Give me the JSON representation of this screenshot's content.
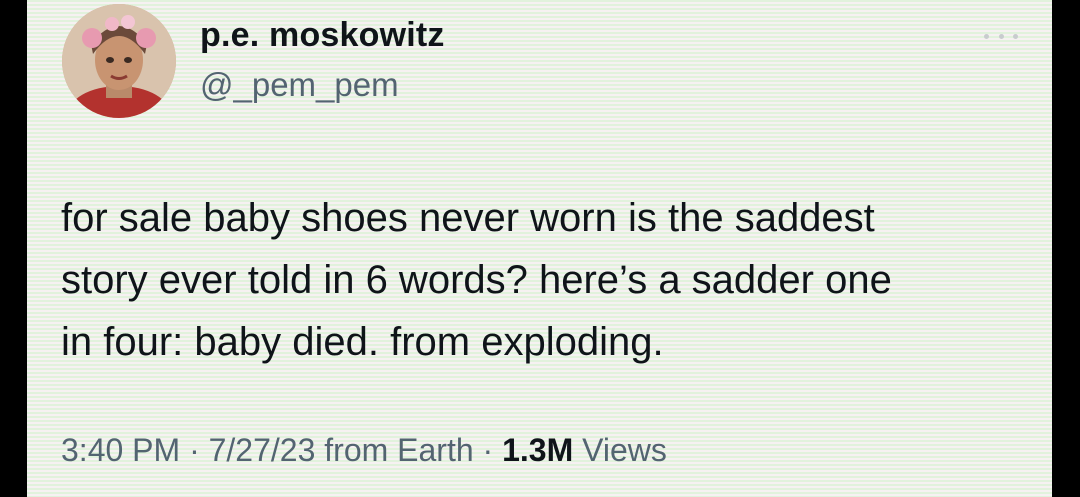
{
  "author": {
    "display_name": "p.e. moskowitz",
    "handle": "@_pem_pem",
    "avatar_icon": "profile-avatar"
  },
  "more_icon": "more-dots-icon",
  "tweet": {
    "lines": [
      "for sale baby shoes never worn is the saddest",
      "story ever told in 6 words? here’s a sadder one",
      "in four: baby died. from exploding."
    ]
  },
  "meta": {
    "time": "3:40 PM",
    "separator": "·",
    "date": "7/27/23",
    "source_prefix": "from",
    "source": "Earth",
    "views_count": "1.3M",
    "views_label": "Views"
  },
  "colors": {
    "background": "#000000",
    "card": "#f3f5ef",
    "text_primary": "#0f1419",
    "text_secondary": "#536471"
  }
}
